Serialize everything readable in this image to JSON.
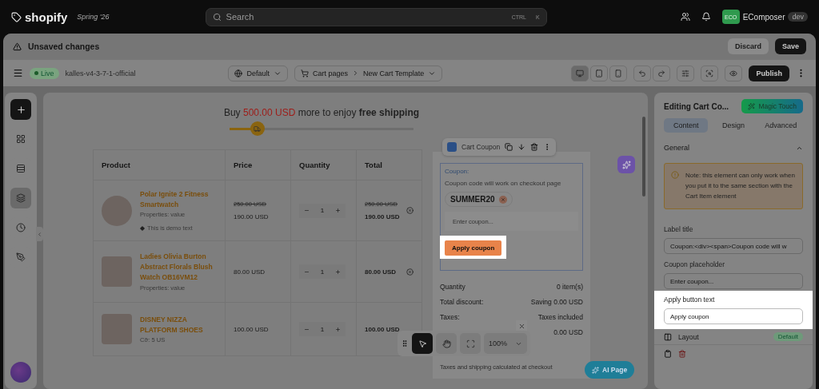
{
  "topbar": {
    "logo": "shopify",
    "edition": "Spring '26",
    "search": {
      "placeholder": "Search",
      "shortcut": [
        "CTRL",
        "K"
      ]
    },
    "store": {
      "initials": "ECO",
      "name": "EComposer",
      "badge": "dev"
    }
  },
  "savebar": {
    "message": "Unsaved changes",
    "buttons": [
      "Discard",
      "Save"
    ]
  },
  "toolbar": {
    "status": "Live",
    "theme": "kalles-v4-3-7-1-official",
    "language": "Default",
    "breadcrumb": [
      "Cart pages",
      "New Cart Template"
    ],
    "devices": [
      {
        "selected": true
      },
      {
        "selected": false
      },
      {
        "selected": false
      }
    ],
    "publish": "Publish"
  },
  "sidebar": {
    "items": [
      {
        "selected": false
      },
      {
        "selected": false
      },
      {
        "selected": true
      },
      {
        "selected": false
      },
      {
        "selected": false
      }
    ]
  },
  "shipping": {
    "prefix": "Buy",
    "amount": "500.00 USD",
    "middle": "more to enjoy",
    "emphasis": "free shipping",
    "level": 0.15
  },
  "table": {
    "columns": [
      "Product",
      "Price",
      "Quantity",
      "Total"
    ],
    "rows": [
      {
        "name": "Polar Ignite 2 Fitness Smartwatch",
        "properties": "Properties: value",
        "note": "This is demo text",
        "price_old": "250.00 USD",
        "price": "190.00 USD",
        "quantity": "1",
        "total_old": "250.00 USD",
        "total": "190.00 USD",
        "removable": true
      },
      {
        "name": "Ladies Olivia Burton Abstract Florals Blush Watch OB16VM12",
        "properties": "Properties: value",
        "price": "80.00 USD",
        "quantity": "1",
        "total": "80.00 USD",
        "removable": true
      },
      {
        "name": "DISNEY NIZZA PLATFORM SHOES",
        "properties": "Cỡ: 5 US",
        "price": "100.00 USD",
        "quantity": "1",
        "total": "100.00 USD",
        "removable": false
      }
    ]
  },
  "coupon": {
    "toolbar_title": "Cart Coupon",
    "label": "Coupon:",
    "description": "Coupon code will work on checkout page",
    "applied_code": "SUMMER20",
    "placeholder": "Enter coupon...",
    "button": "Apply coupon",
    "summary": [
      {
        "label": "Quantity",
        "value": "0 item(s)"
      },
      {
        "label": "Total discount:",
        "value": "Saving 0.00 USD"
      },
      {
        "label": "Taxes:",
        "value": "Taxes included"
      },
      {
        "value": "0.00 USD"
      }
    ],
    "footnote": "Taxes and shipping calculated at checkout"
  },
  "zoombar": {
    "tools": [
      {
        "selected": true
      },
      {
        "selected": false
      },
      {
        "selected": false
      }
    ],
    "zoom": "100%"
  },
  "ai_button": "AI Page",
  "panel": {
    "title": "Editing Cart Co...",
    "magic": "Magic Touch",
    "tabs": [
      {
        "label": "Content",
        "selected": true
      },
      {
        "label": "Design",
        "selected": false
      },
      {
        "label": "Advanced",
        "selected": false
      }
    ],
    "section": {
      "title": "General",
      "expanded": true
    },
    "note": "Note: this element can only work when you put it to the same section with the Cart Item element",
    "fields": [
      {
        "label": "Label title",
        "value": "Coupon:<div><span>Coupon code will w",
        "highlighted": false
      },
      {
        "label": "Coupon placeholder",
        "value": "Enter coupon...",
        "highlighted": false
      },
      {
        "label": "Apply button text",
        "value": "Apply coupon",
        "highlighted": true
      }
    ],
    "layout": {
      "label": "Layout",
      "badge": "Default"
    }
  }
}
